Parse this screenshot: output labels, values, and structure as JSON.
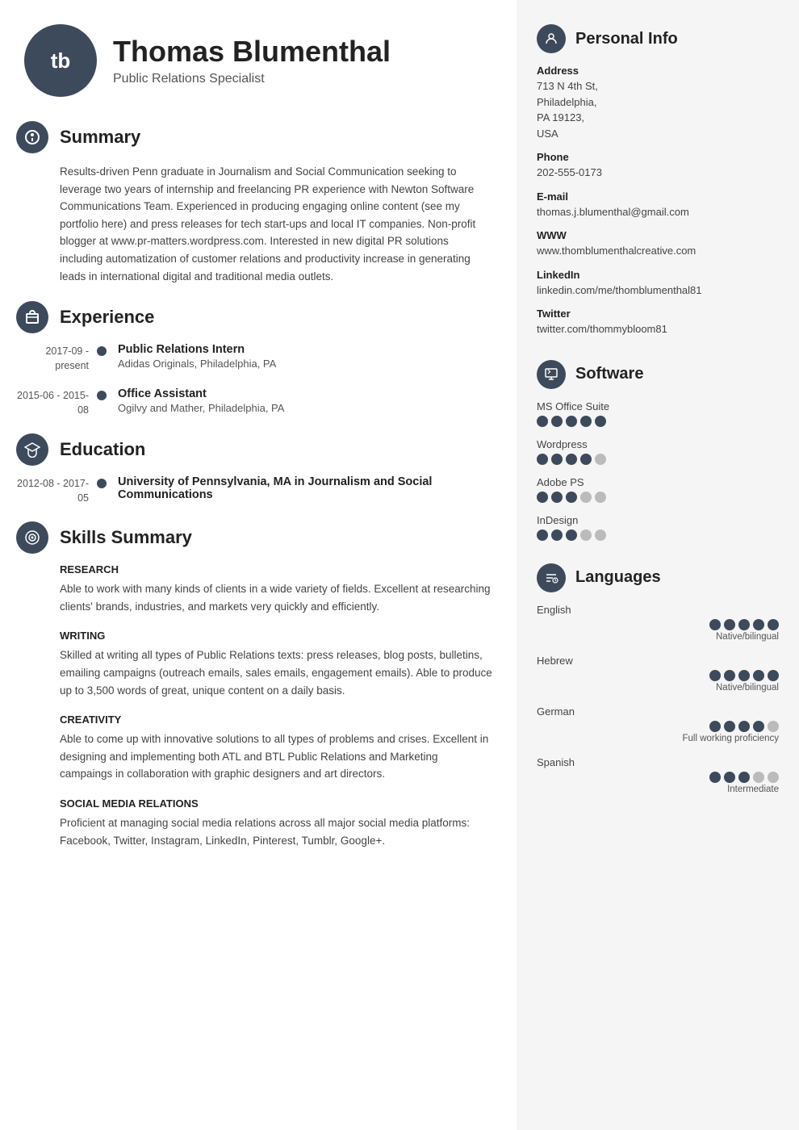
{
  "header": {
    "initials": "tb",
    "name": "Thomas Blumenthal",
    "subtitle": "Public Relations Specialist"
  },
  "sections": {
    "summary": {
      "title": "Summary",
      "icon": "🎯",
      "text": "Results-driven Penn graduate in Journalism and Social Communication seeking to leverage two years of internship and freelancing PR experience with Newton Software Communications Team. Experienced in producing engaging online content (see my portfolio here) and press releases for tech start-ups and local IT companies. Non-profit blogger at www.pr-matters.wordpress.com. Interested in new digital PR solutions including automatization of customer relations and productivity increase in generating leads in international digital and traditional media outlets."
    },
    "experience": {
      "title": "Experience",
      "icon": "💼",
      "items": [
        {
          "date": "2017-09 - present",
          "title": "Public Relations Intern",
          "company": "Adidas Originals, Philadelphia, PA"
        },
        {
          "date": "2015-06 - 2015-08",
          "title": "Office Assistant",
          "company": "Ogilvy and Mather, Philadelphia, PA"
        }
      ]
    },
    "education": {
      "title": "Education",
      "icon": "🎓",
      "items": [
        {
          "date": "2012-08 - 2017-05",
          "title": "University of Pennsylvania, MA in Journalism and Social Communications",
          "company": ""
        }
      ]
    },
    "skills": {
      "title": "Skills Summary",
      "icon": "🎯",
      "categories": [
        {
          "name": "RESEARCH",
          "description": "Able to work with many kinds of clients in a wide variety of fields. Excellent at researching clients' brands, industries, and markets very quickly and efficiently."
        },
        {
          "name": "WRITING",
          "description": "Skilled at writing all types of Public Relations texts: press releases, blog posts, bulletins, emailing campaigns (outreach emails, sales emails, engagement emails). Able to produce up to 3,500 words of great, unique content on a daily basis."
        },
        {
          "name": "CREATIVITY",
          "description": "Able to come up with innovative solutions to all types of problems and crises. Excellent in designing and implementing both ATL and BTL Public Relations and Marketing campaings in collaboration with graphic designers and art directors."
        },
        {
          "name": "SOCIAL MEDIA RELATIONS",
          "description": "Proficient at managing social media relations across all major social media platforms: Facebook, Twitter, Instagram, LinkedIn, Pinterest, Tumblr, Google+."
        }
      ]
    }
  },
  "personal_info": {
    "section_title": "Personal Info",
    "address_label": "Address",
    "address_value": "713 N 4th St,\nPhiladelphia,\nPA 19123,\nUSA",
    "phone_label": "Phone",
    "phone_value": "202-555-0173",
    "email_label": "E-mail",
    "email_value": "thomas.j.blumenthal@gmail.com",
    "www_label": "WWW",
    "www_value": "www.thomblumenthalcreative.com",
    "linkedin_label": "LinkedIn",
    "linkedin_value": "linkedin.com/me/thomblumenthal81",
    "twitter_label": "Twitter",
    "twitter_value": "twitter.com/thommybloom81"
  },
  "software": {
    "section_title": "Software",
    "items": [
      {
        "name": "MS Office Suite",
        "filled": 5,
        "total": 5
      },
      {
        "name": "Wordpress",
        "filled": 4,
        "total": 5
      },
      {
        "name": "Adobe PS",
        "filled": 3,
        "total": 5
      },
      {
        "name": "InDesign",
        "filled": 3,
        "total": 5
      }
    ]
  },
  "languages": {
    "section_title": "Languages",
    "items": [
      {
        "name": "English",
        "filled": 5,
        "total": 5,
        "level": "Native/bilingual"
      },
      {
        "name": "Hebrew",
        "filled": 5,
        "total": 5,
        "level": "Native/bilingual"
      },
      {
        "name": "German",
        "filled": 4,
        "total": 5,
        "level": "Full working proficiency"
      },
      {
        "name": "Spanish",
        "filled": 3,
        "total": 5,
        "level": "Intermediate"
      }
    ]
  }
}
